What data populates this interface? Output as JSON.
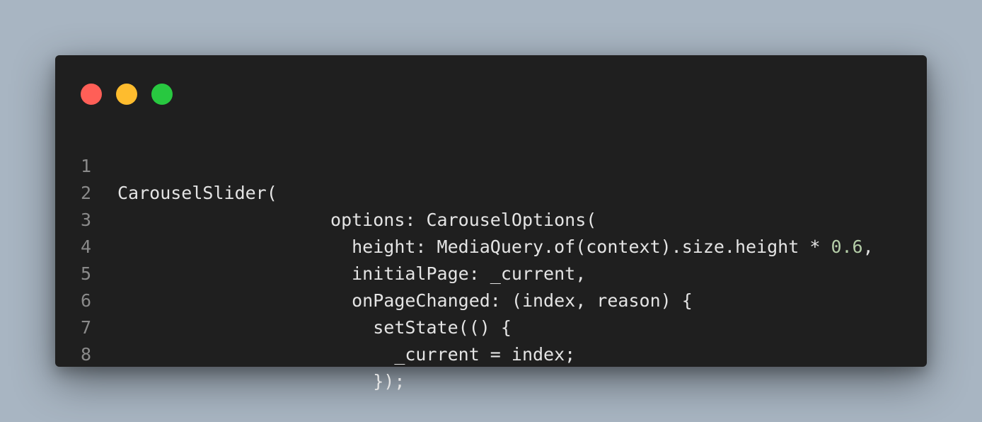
{
  "window": {
    "buttons": [
      {
        "name": "close",
        "color": "#ff5f57"
      },
      {
        "name": "minimize",
        "color": "#febc2e"
      },
      {
        "name": "maximize",
        "color": "#28c840"
      }
    ]
  },
  "code": {
    "lines": [
      {
        "number": "1",
        "text": "CarouselSlider("
      },
      {
        "number": "2",
        "text": "                    options: CarouselOptions("
      },
      {
        "number": "3",
        "text": "                      height: MediaQuery.of(context).size.height * ",
        "number_literal": "0.6",
        "after": ","
      },
      {
        "number": "4",
        "text": "                      initialPage: _current,"
      },
      {
        "number": "5",
        "text": "                      onPageChanged: (index, reason) {"
      },
      {
        "number": "6",
        "text": "                        setState(() {"
      },
      {
        "number": "7",
        "text": "                          _current = index;"
      },
      {
        "number": "8",
        "text": "                        });"
      }
    ]
  }
}
